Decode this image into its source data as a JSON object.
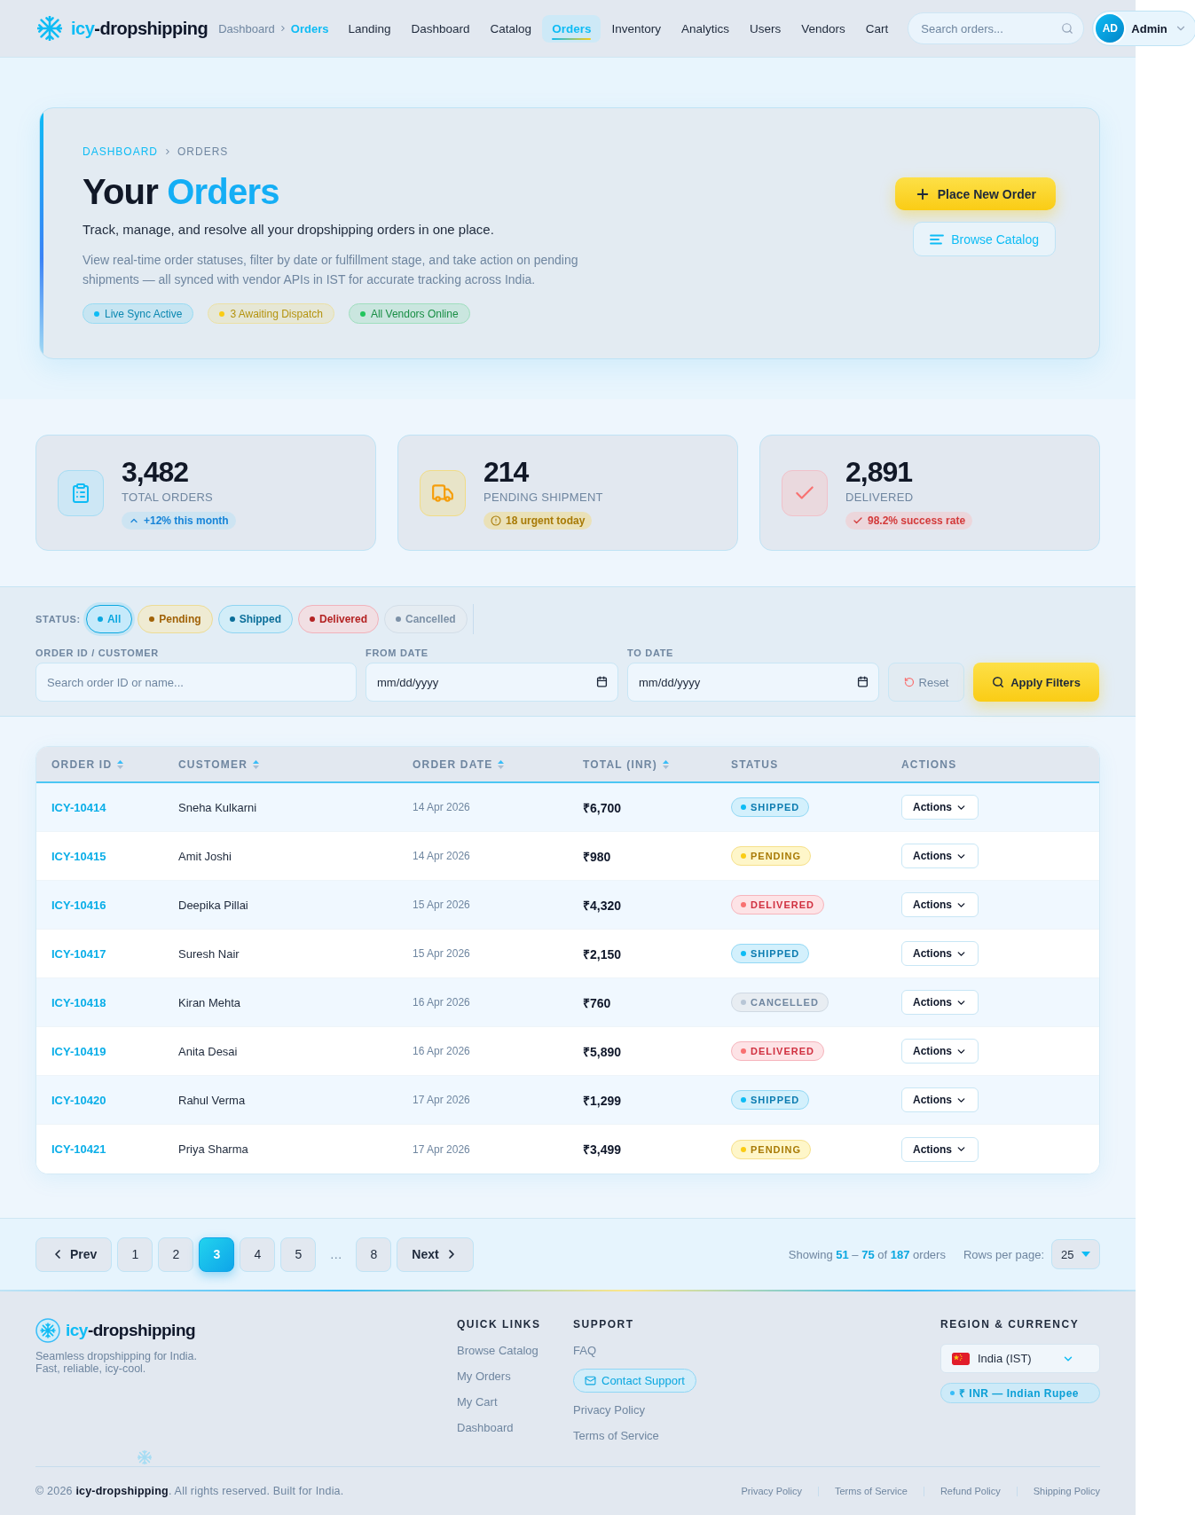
{
  "header": {
    "brand": {
      "accent": "icy",
      "rest": "-dropshipping"
    },
    "breadcrumb": [
      {
        "label": "Dashboard",
        "current": false
      },
      {
        "label": "Orders",
        "current": true
      }
    ],
    "nav": [
      {
        "label": "Landing",
        "selected": false
      },
      {
        "label": "Dashboard",
        "selected": false
      },
      {
        "label": "Catalog",
        "selected": false
      },
      {
        "label": "Orders",
        "selected": true
      },
      {
        "label": "Inventory",
        "selected": false
      },
      {
        "label": "Analytics",
        "selected": false
      },
      {
        "label": "Users",
        "selected": false
      },
      {
        "label": "Vendors",
        "selected": false
      },
      {
        "label": "Cart",
        "selected": false
      }
    ],
    "search": {
      "placeholder": "Search orders..."
    },
    "user": {
      "initials": "AD",
      "name": "Admin"
    }
  },
  "hero": {
    "breadcrumb": [
      {
        "label": "DASHBOARD",
        "current": false
      },
      {
        "label": "ORDERS",
        "current": true
      }
    ],
    "title": {
      "lead": "Your",
      "highlight": "Orders"
    },
    "subtitle": "Track, manage, and resolve all your dropshipping orders in one place.",
    "description": "View real-time order statuses, filter by date or fulfillment stage, and take action on pending shipments — all synced with vendor APIs in IST for accurate tracking across India.",
    "badges": [
      {
        "label": "Live Sync Active",
        "color": "#0ebcf5"
      },
      {
        "label": "3 Awaiting Dispatch",
        "color": "#facc15"
      },
      {
        "label": "All Vendors Online",
        "color": "#22c55e"
      }
    ],
    "actions": [
      {
        "label": "Place New Order",
        "kind": "primary"
      },
      {
        "label": "Browse Catalog",
        "kind": "secondary"
      }
    ]
  },
  "stats": [
    {
      "kind": "orders",
      "value": "3,482",
      "label": "TOTAL ORDERS",
      "note": "+12% this month"
    },
    {
      "kind": "pending",
      "value": "214",
      "label": "PENDING SHIPMENT",
      "note": "18 urgent today"
    },
    {
      "kind": "delivered",
      "value": "2,891",
      "label": "DELIVERED",
      "note": "98.2% success rate"
    }
  ],
  "filters": {
    "status_label": "STATUS:",
    "statuses": [
      {
        "label": "All",
        "kind": "all",
        "selected": true
      },
      {
        "label": "Pending",
        "kind": "pending",
        "selected": false
      },
      {
        "label": "Shipped",
        "kind": "shipped",
        "selected": false
      },
      {
        "label": "Delivered",
        "kind": "delivered",
        "selected": false
      },
      {
        "label": "Cancelled",
        "kind": "cancelled",
        "selected": false
      }
    ],
    "fields": [
      {
        "kind": "text",
        "label": "ORDER ID / CUSTOMER",
        "placeholder": "Search order ID or name..."
      },
      {
        "kind": "date",
        "label": "FROM DATE",
        "placeholder": "mm/dd/yyyy"
      },
      {
        "kind": "date",
        "label": "TO DATE",
        "placeholder": "mm/dd/yyyy"
      }
    ],
    "buttons": [
      {
        "kind": "reset",
        "label": "Reset"
      },
      {
        "kind": "apply",
        "label": "Apply Filters"
      }
    ]
  },
  "table": {
    "columns": [
      {
        "label": "ORDER ID",
        "sortable": true
      },
      {
        "label": "CUSTOMER",
        "sortable": true
      },
      {
        "label": "ORDER DATE",
        "sortable": true
      },
      {
        "label": "TOTAL (INR)",
        "sortable": true
      },
      {
        "label": "STATUS",
        "sortable": false
      },
      {
        "label": "ACTIONS",
        "sortable": false
      }
    ],
    "rows": [
      {
        "order_id": "ICY-10414",
        "customer": "Sneha Kulkarni",
        "date": "14 Apr 2026",
        "total": "₹6,700",
        "status": {
          "label": "SHIPPED",
          "kind": "shipped"
        },
        "action": "Actions"
      },
      {
        "order_id": "ICY-10415",
        "customer": "Amit Joshi",
        "date": "14 Apr 2026",
        "total": "₹980",
        "status": {
          "label": "PENDING",
          "kind": "pending"
        },
        "action": "Actions"
      },
      {
        "order_id": "ICY-10416",
        "customer": "Deepika Pillai",
        "date": "15 Apr 2026",
        "total": "₹4,320",
        "status": {
          "label": "DELIVERED",
          "kind": "delivered"
        },
        "action": "Actions"
      },
      {
        "order_id": "ICY-10417",
        "customer": "Suresh Nair",
        "date": "15 Apr 2026",
        "total": "₹2,150",
        "status": {
          "label": "SHIPPED",
          "kind": "shipped"
        },
        "action": "Actions"
      },
      {
        "order_id": "ICY-10418",
        "customer": "Kiran Mehta",
        "date": "16 Apr 2026",
        "total": "₹760",
        "status": {
          "label": "CANCELLED",
          "kind": "cancelled"
        },
        "action": "Actions"
      },
      {
        "order_id": "ICY-10419",
        "customer": "Anita Desai",
        "date": "16 Apr 2026",
        "total": "₹5,890",
        "status": {
          "label": "DELIVERED",
          "kind": "delivered"
        },
        "action": "Actions"
      },
      {
        "order_id": "ICY-10420",
        "customer": "Rahul Verma",
        "date": "17 Apr 2026",
        "total": "₹1,299",
        "status": {
          "label": "SHIPPED",
          "kind": "shipped"
        },
        "action": "Actions"
      },
      {
        "order_id": "ICY-10421",
        "customer": "Priya Sharma",
        "date": "17 Apr 2026",
        "total": "₹3,499",
        "status": {
          "label": "PENDING",
          "kind": "pending"
        },
        "action": "Actions"
      }
    ]
  },
  "pagination": {
    "prev": "Prev",
    "pages": [
      {
        "kind": "page",
        "label": "1",
        "selected": false
      },
      {
        "kind": "page",
        "label": "2",
        "selected": false
      },
      {
        "kind": "page",
        "label": "3",
        "selected": true
      },
      {
        "kind": "page",
        "label": "4",
        "selected": false
      },
      {
        "kind": "page",
        "label": "5",
        "selected": false
      },
      {
        "kind": "ellipsis",
        "label": "…"
      },
      {
        "kind": "page",
        "label": "8",
        "selected": false
      }
    ],
    "next": "Next",
    "summary": "Showing **51** – **75** of **187** orders",
    "rows_label": "Rows per page:",
    "rows_value": "25"
  },
  "footer": {
    "brand": {
      "accent": "icy",
      "rest": "-dropshipping"
    },
    "tagline": [
      "Seamless dropshipping for India.",
      "Fast, reliable, icy-cool."
    ],
    "columns": [
      {
        "title": "QUICK LINKS",
        "links": [
          {
            "kind": "link",
            "label": "Browse Catalog"
          },
          {
            "kind": "link",
            "label": "My Orders"
          },
          {
            "kind": "link",
            "label": "My Cart"
          },
          {
            "kind": "link",
            "label": "Dashboard"
          }
        ]
      },
      {
        "title": "SUPPORT",
        "links": [
          {
            "kind": "link",
            "label": "FAQ"
          },
          {
            "kind": "button",
            "label": "Contact Support"
          },
          {
            "kind": "link",
            "label": "Privacy Policy"
          },
          {
            "kind": "link",
            "label": "Terms of Service"
          }
        ]
      }
    ],
    "region": {
      "title": "REGION & CURRENCY",
      "country": "India (IST)",
      "currency": "₹ INR — Indian Rupee"
    },
    "copyright": "© 2026 **icy-dropshipping**. All rights reserved. Built for India.",
    "legal": [
      "Privacy Policy",
      "Terms of Service",
      "Refund Policy",
      "Shipping Policy"
    ]
  }
}
